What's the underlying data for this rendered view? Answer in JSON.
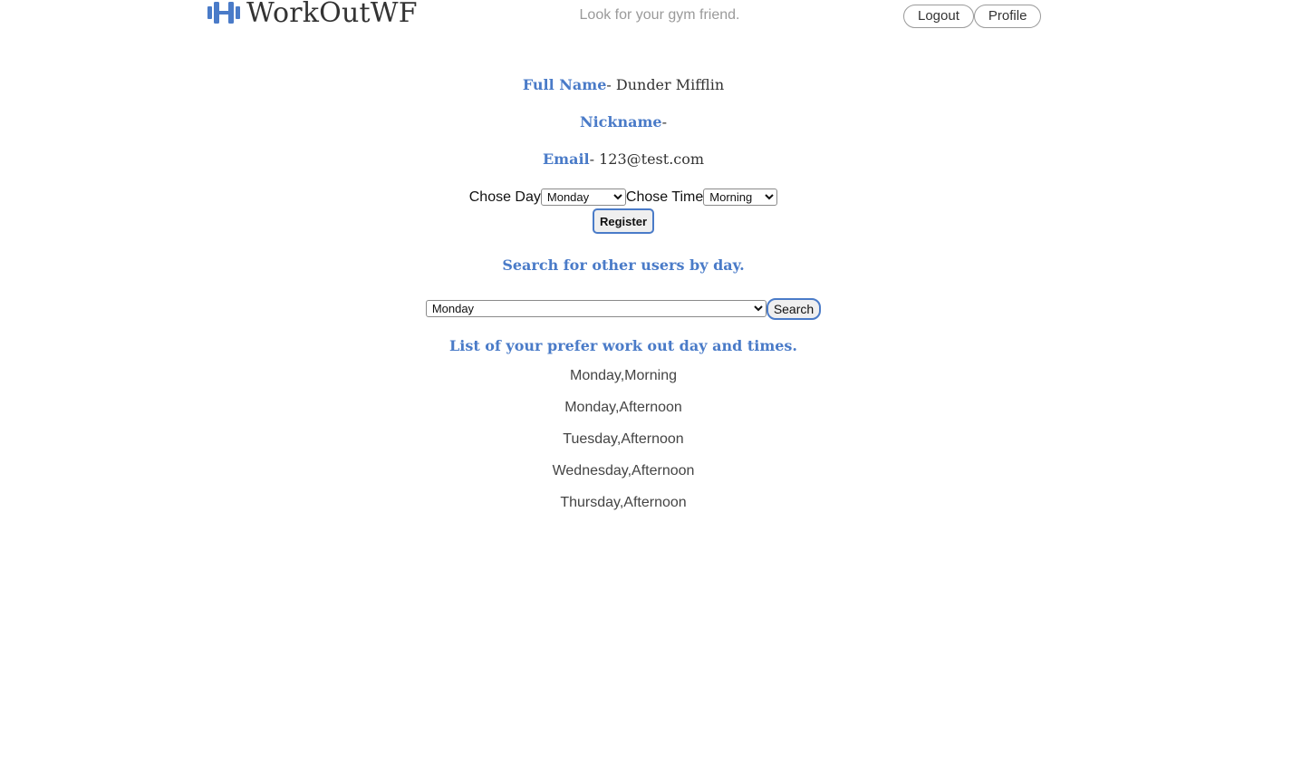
{
  "header": {
    "logo_text": "WorkOutWF",
    "tagline": "Look for your gym friend.",
    "logo_icon": "dumbbell-icon",
    "accent_color": "#4a7bc8",
    "nav": {
      "logout_label": "Logout",
      "profile_label": "Profile"
    }
  },
  "profile": {
    "full_name_label": "Full Name",
    "full_name_value": "Dunder Mifflin",
    "nickname_label": "Nickname",
    "nickname_value": "",
    "email_label": "Email",
    "email_value": "123@test.com"
  },
  "register": {
    "day_label": "Chose Day",
    "day_selected": "Monday",
    "time_label": "Chose Time",
    "time_selected": "Morning",
    "button_label": "Register"
  },
  "search": {
    "title": "Search for other users by day.",
    "selected_day": "Monday",
    "button_label": "Search"
  },
  "preferences": {
    "title": "List of your prefer work out day and times.",
    "items": [
      "Monday,Morning",
      "Monday,Afternoon",
      "Tuesday,Afternoon",
      "Wednesday,Afternoon",
      "Thursday,Afternoon"
    ]
  }
}
